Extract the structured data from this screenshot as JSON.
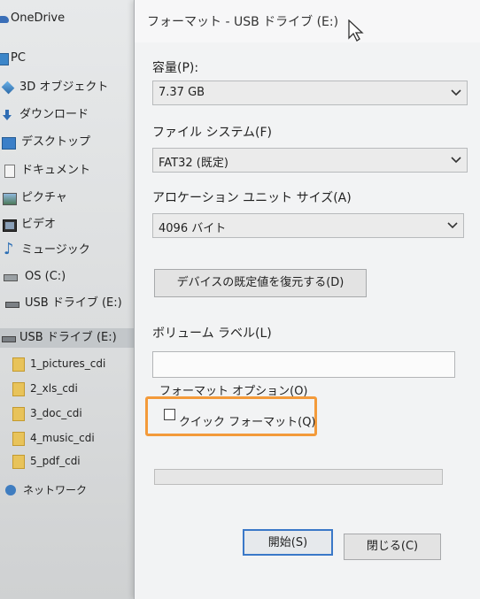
{
  "explorer": {
    "nav_items": [
      {
        "label": "OneDrive",
        "icon": "onedrive-icon"
      },
      {
        "label": "PC",
        "icon": "pc-icon"
      },
      {
        "label": "3D オブジェクト",
        "icon": "3d-objects-icon"
      },
      {
        "label": "ダウンロード",
        "icon": "downloads-icon"
      },
      {
        "label": "デスクトップ",
        "icon": "desktop-icon"
      },
      {
        "label": "ドキュメント",
        "icon": "documents-icon"
      },
      {
        "label": "ピクチャ",
        "icon": "pictures-icon"
      },
      {
        "label": "ビデオ",
        "icon": "videos-icon"
      },
      {
        "label": "ミュージック",
        "icon": "music-icon"
      },
      {
        "label": "OS (C:)",
        "icon": "drive-icon"
      },
      {
        "label": "USB ドライブ (E:)",
        "icon": "usb-drive-icon"
      },
      {
        "label": "USB ドライブ (E:)",
        "icon": "usb-drive-icon"
      },
      {
        "label": "1_pictures_cdi",
        "icon": "folder-icon"
      },
      {
        "label": "2_xls_cdi",
        "icon": "folder-icon"
      },
      {
        "label": "3_doc_cdi",
        "icon": "folder-icon"
      },
      {
        "label": "4_music_cdi",
        "icon": "folder-icon"
      },
      {
        "label": "5_pdf_cdi",
        "icon": "folder-icon"
      },
      {
        "label": "ネットワーク",
        "icon": "network-icon"
      }
    ]
  },
  "dialog": {
    "title": "フォーマット - USB ドライブ (E:)",
    "capacity_label": "容量(P):",
    "capacity_value": "7.37 GB",
    "filesystem_label": "ファイル システム(F)",
    "filesystem_value": "FAT32 (既定)",
    "allocation_label": "アロケーション ユニット サイズ(A)",
    "allocation_value": "4096 バイト",
    "restore_defaults_label": "デバイスの既定値を復元する(D)",
    "volume_label": "ボリューム ラベル(L)",
    "volume_value": "",
    "format_options_label": "フォーマット オプション(O)",
    "quick_format_label": "クイック フォーマット(Q)",
    "quick_format_checked": false,
    "progress": 0,
    "start_label": "開始(S)",
    "close_label": "閉じる(C)"
  },
  "colors": {
    "highlight": "#f39a3a",
    "accent": "#2f6db4"
  }
}
